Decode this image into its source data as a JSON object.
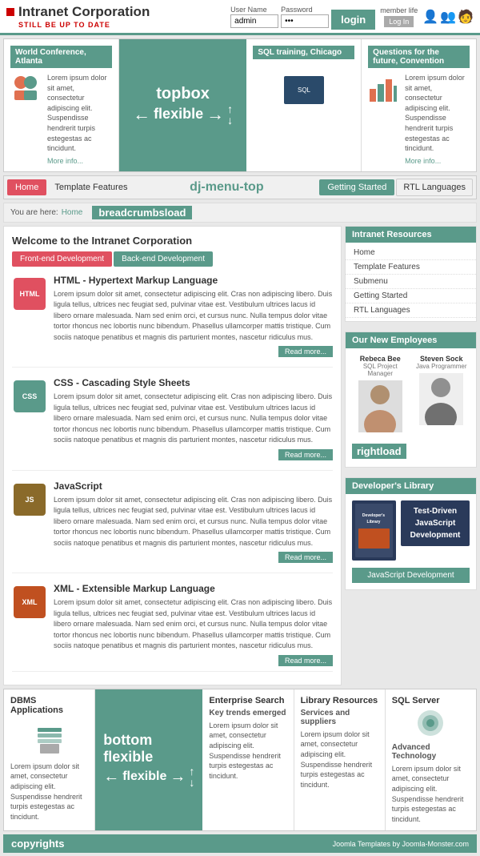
{
  "header": {
    "logo_title": "Intranet Corporation",
    "logo_sub": "STILL BE UP TO DATE",
    "login_label": "User Name",
    "password_label": "Password",
    "username_value": "admin",
    "password_value": "...",
    "login_button": "login",
    "member_life": "member life",
    "log_in": "Log In"
  },
  "topboxes": [
    {
      "title": "World Conference, Atlanta",
      "text": "Lorem ipsum dolor sit amet, consectetur adipiscing elit. Suspendisse hendrerit turpis estegestas ac tincidunt.",
      "link": "More info..."
    },
    {
      "title": "topbox flexible",
      "arrow_left": "←",
      "arrow_right": "→",
      "arrow_up": "↑",
      "arrow_down": "↓"
    },
    {
      "title": "SQL training, Chicago",
      "text": "",
      "link": ""
    },
    {
      "title": "Questions for the future, Convention",
      "text": "Lorem ipsum dolor sit amet, consectetur adipiscing elit. Suspendisse hendrerit turpis estegestas ac tincidunt.",
      "link": "More info..."
    }
  ],
  "nav": {
    "label": "dj-menu-top",
    "items": [
      {
        "label": "Home",
        "active": true
      },
      {
        "label": "Template Features",
        "active": false
      },
      {
        "label": "Getting Started",
        "active": false
      },
      {
        "label": "RTL Languages",
        "active": false
      }
    ]
  },
  "breadcrumb": {
    "label": "breadcrumbsload",
    "you_are_here": "You are here:",
    "home": "Home"
  },
  "content": {
    "title": "Welcome to the Intranet Corporation",
    "tabs": [
      {
        "label": "Front-end Development",
        "active": true
      },
      {
        "label": "Back-end Development",
        "active": false
      }
    ],
    "articles": [
      {
        "icon_label": "HTML",
        "icon_class": "icon-html",
        "title": "HTML - Hypertext Markup Language",
        "text": "Lorem ipsum dolor sit amet, consectetur adipiscing elit. Cras non adipiscing libero. Duis ligula tellus, ultrices nec feugiat sed, pulvinar vitae est. Vestibulum ultrices lacus id libero ornare malesuada. Nam sed enim orci, et cursus nunc. Nulla tempus dolor vitae tortor rhoncus nec lobortis nunc bibendum. Phasellus ullamcorper mattis tristique. Cum sociis natoque penatibus et magnis dis parturient montes, nascetur ridiculus mus.",
        "read_more": "Read more..."
      },
      {
        "icon_label": "CSS",
        "icon_class": "icon-css",
        "title": "CSS - Cascading Style Sheets",
        "text": "Lorem ipsum dolor sit amet, consectetur adipiscing elit. Cras non adipiscing libero. Duis ligula tellus, ultrices nec feugiat sed, pulvinar vitae est. Vestibulum ultrices lacus id libero ornare malesuada. Nam sed enim orci, et cursus nunc. Nulla tempus dolor vitae tortor rhoncus nec lobortis nunc bibendum. Phasellus ullamcorper mattis tristique. Cum sociis natoque penatibus et magnis dis parturient montes, nascetur ridiculus mus.",
        "read_more": "Read more..."
      },
      {
        "icon_label": "JS",
        "icon_class": "icon-js",
        "title": "JavaScript",
        "text": "Lorem ipsum dolor sit amet, consectetur adipiscing elit. Cras non adipiscing libero. Duis ligula tellus, ultrices nec feugiat sed, pulvinar vitae est. Vestibulum ultrices lacus id libero ornare malesuada. Nam sed enim orci, et cursus nunc. Nulla tempus dolor vitae tortor rhoncus nec lobortis nunc bibendum. Phasellus ullamcorper mattis tristique. Cum sociis natoque penatibus et magnis dis parturient montes, nascetur ridiculus mus.",
        "read_more": "Read more..."
      },
      {
        "icon_label": "XML",
        "icon_class": "icon-xml",
        "title": "XML - Extensible Markup Language",
        "text": "Lorem ipsum dolor sit amet, consectetur adipiscing elit. Cras non adipiscing libero. Duis ligula tellus, ultrices nec feugiat sed, pulvinar vitae est. Vestibulum ultrices lacus id libero ornare malesuada. Nam sed enim orci, et cursus nunc. Nulla tempus dolor vitae tortor rhoncus nec lobortis nunc bibendum. Phasellus ullamcorper mattis tristique. Cum sociis natoque penatibus et magnis dis parturient montes, nascetur ridiculus mus.",
        "read_more": "Read more..."
      }
    ]
  },
  "sidebar": {
    "intranet_resources_title": "Intranet Resources",
    "menu_items": [
      "Home",
      "Template Features",
      "Submenu",
      "Getting Started",
      "RTL Languages"
    ],
    "new_employees_title": "Our New Employees",
    "employees": [
      {
        "name": "Rebeca Bee",
        "role": "SQL Project Manager"
      },
      {
        "name": "Steven Sock",
        "role": "Java Programmer"
      }
    ],
    "rightload_label": "rightload",
    "dev_library_title": "Developer's Library",
    "book_title": "Test-Driven JavaScript Development",
    "dev_link": "JavaScript Development"
  },
  "bottomboxes": [
    {
      "title": "DBMS Applications",
      "text": "Lorem ipsum dolor sit amet, consectetur adipiscing elit. Suspendisse hendrerit turpis estegestas ac tincidunt."
    },
    {
      "title": "bottom flexible",
      "is_flexible": true
    },
    {
      "title": "Enterprise Search",
      "text": "Key trends emerged",
      "body": "Lorem ipsum dolor sit amet, consectetur adipiscing elit. Suspendisse hendrerit turpis estegestas ac tincidunt."
    },
    {
      "title": "Library Resources",
      "text": "Services and suppliers",
      "body": "Lorem ipsum dolor sit amet, consectetur adipiscing elit. Suspendisse hendrerit turpis estegestas ac tincidunt."
    },
    {
      "title": "SQL Server",
      "text": "Advanced Technology",
      "body": "Lorem ipsum dolor sit amet, consectetur adipiscing elit. Suspendisse hendrerit turpis estegestas ac tincidunt."
    }
  ],
  "footer": {
    "label": "copyrights",
    "joomla_text": "Joomla Templates by Joomla-Monster.com"
  }
}
